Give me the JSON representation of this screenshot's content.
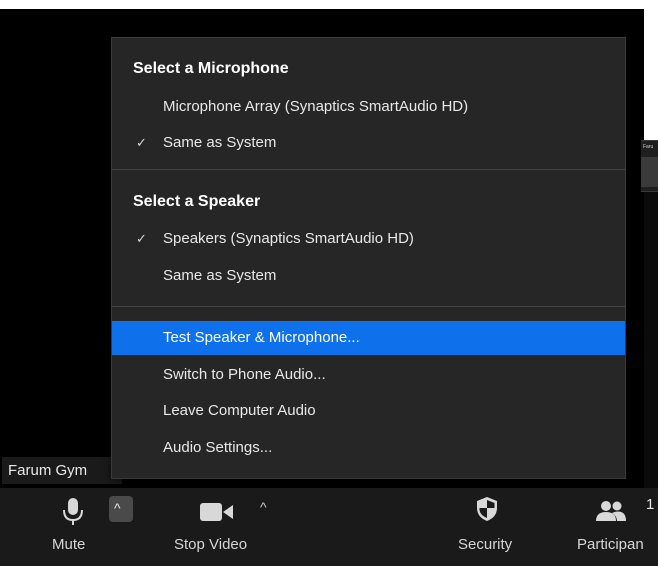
{
  "participant_name": "Farum Gym",
  "thumbnail_label": "Faru",
  "audio_menu": {
    "microphone_heading": "Select a Microphone",
    "microphones": [
      {
        "label": "Microphone Array (Synaptics SmartAudio HD)",
        "checked": false,
        "check": ""
      },
      {
        "label": "Same as System",
        "checked": true,
        "check": "✓"
      }
    ],
    "speaker_heading": "Select a Speaker",
    "speakers": [
      {
        "label": "Speakers (Synaptics SmartAudio HD)",
        "checked": true,
        "check": "✓"
      },
      {
        "label": "Same as System",
        "checked": false,
        "check": ""
      }
    ],
    "actions": [
      {
        "label": "Test Speaker & Microphone...",
        "highlighted": true
      },
      {
        "label": "Switch to Phone Audio...",
        "highlighted": false
      },
      {
        "label": "Leave Computer Audio",
        "highlighted": false
      },
      {
        "label": "Audio Settings...",
        "highlighted": false
      }
    ]
  },
  "toolbar": {
    "mute_label": "Mute",
    "mute_caret": "^",
    "video_label": "Stop Video",
    "video_caret": "^",
    "security_label": "Security",
    "participants_label": "Participan",
    "participants_count": "1"
  },
  "colors": {
    "menu_background": "#262626",
    "highlight": "#0e71eb",
    "toolbar_background": "#1a1a1a"
  }
}
